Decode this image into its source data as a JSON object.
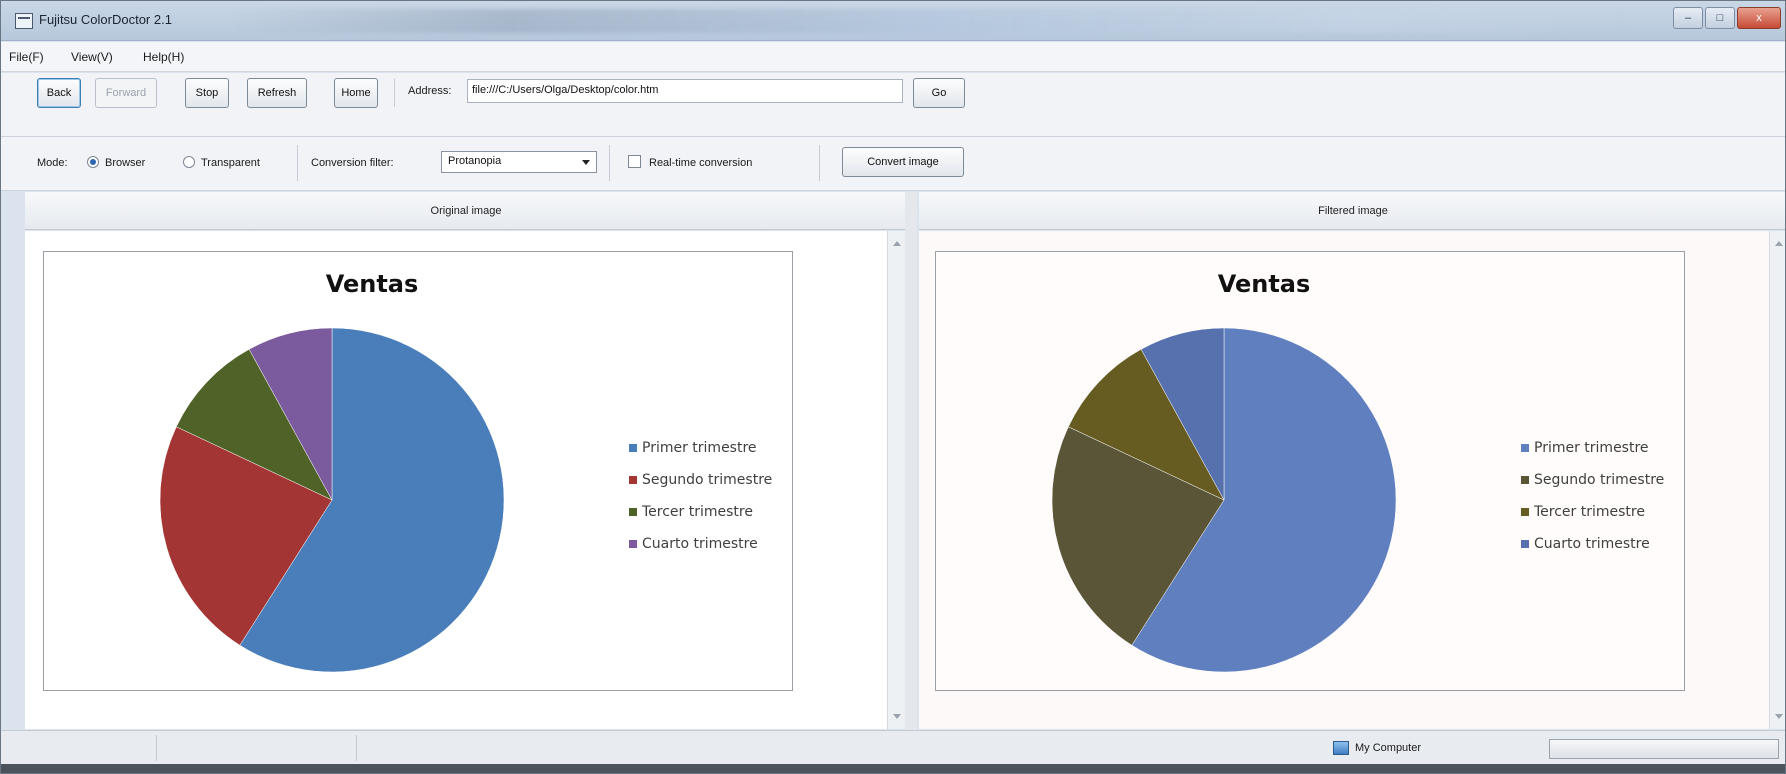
{
  "window": {
    "title": "Fujitsu ColorDoctor 2.1",
    "buttons": {
      "minimize": "–",
      "maximize": "□",
      "close": "x"
    }
  },
  "menu": {
    "items": [
      "File(F)",
      "View(V)",
      "Help(H)"
    ]
  },
  "toolbar": {
    "back": "Back",
    "forward": "Forward",
    "stop": "Stop",
    "refresh": "Refresh",
    "home": "Home",
    "address_label": "Address:",
    "address_value": "file:///C:/Users/Olga/Desktop/color.htm",
    "go": "Go"
  },
  "options": {
    "mode_label": "Mode:",
    "mode_browser": "Browser",
    "mode_transparent": "Transparent",
    "mode_selected": "Browser",
    "conversion_filter_label": "Conversion filter:",
    "conversion_filter_value": "Protanopia",
    "realtime_label": "Real-time conversion",
    "realtime_checked": false,
    "convert_button": "Convert image"
  },
  "panels": {
    "original_header": "Original image",
    "filtered_header": "Filtered image"
  },
  "chart_data": [
    {
      "type": "pie",
      "title": "Ventas",
      "categories": [
        "Primer trimestre",
        "Segundo trimestre",
        "Tercer trimestre",
        "Cuarto trimestre"
      ],
      "values": [
        59,
        23,
        10,
        8
      ],
      "colors": [
        "#4a7ebb",
        "#a33634",
        "#4f6228",
        "#7c5a9e"
      ],
      "legend_position": "right"
    },
    {
      "type": "pie",
      "title": "Ventas",
      "categories": [
        "Primer trimestre",
        "Segundo trimestre",
        "Tercer trimestre",
        "Cuarto trimestre"
      ],
      "values": [
        59,
        23,
        10,
        8
      ],
      "colors": [
        "#5f7fbf",
        "#5a5536",
        "#665c22",
        "#5671ae"
      ],
      "legend_position": "right"
    }
  ],
  "status": {
    "zone_label": "My Computer"
  }
}
